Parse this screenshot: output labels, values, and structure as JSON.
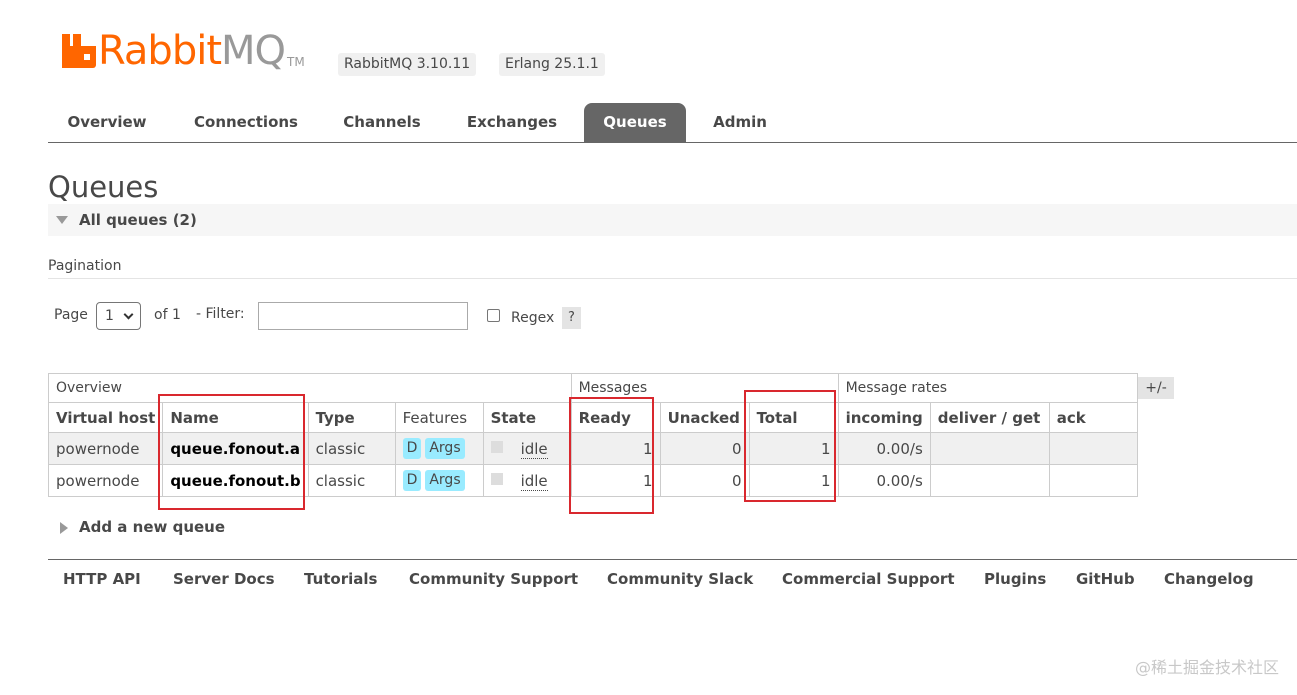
{
  "brand": {
    "logo_text_1": "Rabbit",
    "logo_text_2": "MQ",
    "logo_tm": "TM",
    "version": "RabbitMQ 3.10.11",
    "erlang": "Erlang 25.1.1",
    "accent_color": "#ff6600"
  },
  "tabs": [
    {
      "label": "Overview",
      "active": false
    },
    {
      "label": "Connections",
      "active": false
    },
    {
      "label": "Channels",
      "active": false
    },
    {
      "label": "Exchanges",
      "active": false
    },
    {
      "label": "Queues",
      "active": true
    },
    {
      "label": "Admin",
      "active": false
    }
  ],
  "page": {
    "title": "Queues",
    "section_label": "All queues (2)",
    "pagination_label": "Pagination"
  },
  "filter": {
    "page_label": "Page",
    "page_value": "1",
    "of_label": "of 1",
    "filter_label": "- Filter:",
    "filter_value": "",
    "regex_label": "Regex",
    "regex_checked": false,
    "help_label": "?"
  },
  "table": {
    "groups": [
      "Overview",
      "Messages",
      "Message rates"
    ],
    "headers": [
      "Virtual host",
      "Name",
      "Type",
      "Features",
      "State",
      "Ready",
      "Unacked",
      "Total",
      "incoming",
      "deliver / get",
      "ack"
    ],
    "columns_toggle": "+/-",
    "rows": [
      {
        "vhost": "powernode",
        "name": "queue.fonout.a",
        "type": "classic",
        "features": [
          "D",
          "Args"
        ],
        "state": "idle",
        "ready": "1",
        "unacked": "0",
        "total": "1",
        "incoming": "0.00/s",
        "deliver_get": "",
        "ack": ""
      },
      {
        "vhost": "powernode",
        "name": "queue.fonout.b",
        "type": "classic",
        "features": [
          "D",
          "Args"
        ],
        "state": "idle",
        "ready": "1",
        "unacked": "0",
        "total": "1",
        "incoming": "0.00/s",
        "deliver_get": "",
        "ack": ""
      }
    ]
  },
  "add_queue_label": "Add a new queue",
  "footer_links": [
    "HTTP API",
    "Server Docs",
    "Tutorials",
    "Community Support",
    "Community Slack",
    "Commercial Support",
    "Plugins",
    "GitHub",
    "Changelog"
  ],
  "watermark": "@稀土掘金技术社区"
}
